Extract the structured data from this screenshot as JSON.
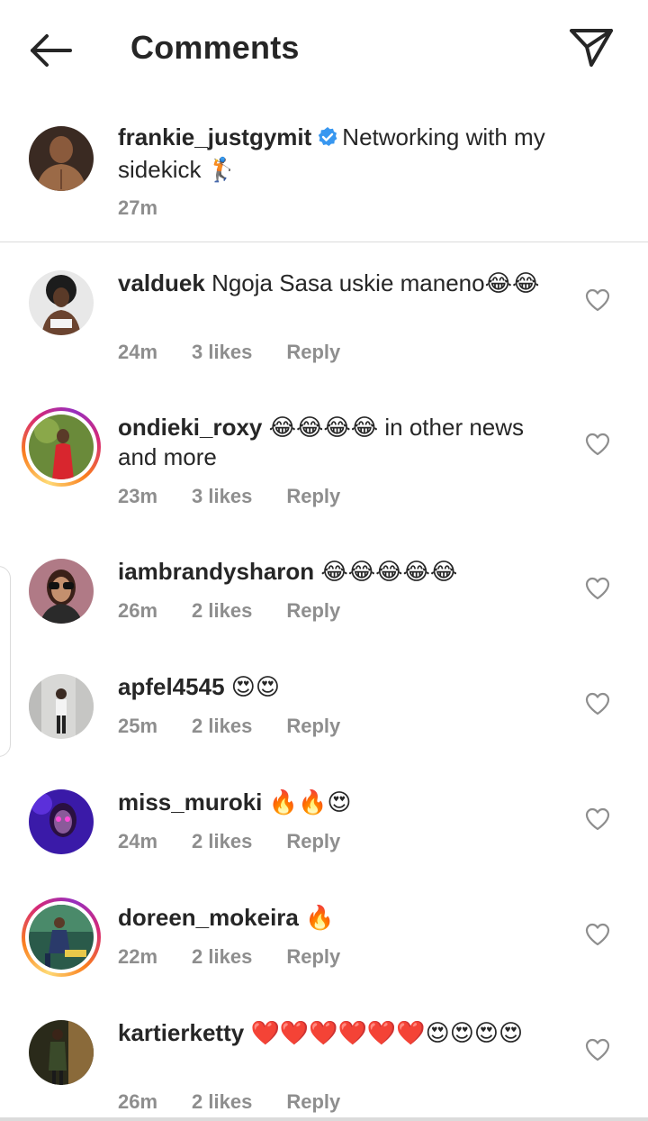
{
  "header": {
    "title": "Comments",
    "back_icon": "arrow-left-icon",
    "share_icon": "send-paper-plane-icon"
  },
  "caption": {
    "username": "frankie_justgymit",
    "verified": true,
    "text": "Networking with my sidekick 🏌",
    "time": "27m"
  },
  "comments": [
    {
      "username": "valduek",
      "text": "Ngoja Sasa uskie maneno😂😂",
      "time": "24m",
      "likes": "3 likes",
      "reply": "Reply",
      "story_ring": false
    },
    {
      "username": "ondieki_roxy",
      "text": "😂😂😂😂 in other news and more",
      "time": "23m",
      "likes": "3 likes",
      "reply": "Reply",
      "story_ring": true
    },
    {
      "username": "iambrandysharon",
      "text": "😂😂😂😂😂",
      "time": "26m",
      "likes": "2 likes",
      "reply": "Reply",
      "story_ring": false
    },
    {
      "username": "apfel4545",
      "text": "😍😍",
      "time": "25m",
      "likes": "2 likes",
      "reply": "Reply",
      "story_ring": false
    },
    {
      "username": "miss_muroki",
      "text": "🔥🔥😍",
      "time": "24m",
      "likes": "2 likes",
      "reply": "Reply",
      "story_ring": false
    },
    {
      "username": "doreen_mokeira",
      "text": "🔥",
      "time": "22m",
      "likes": "2 likes",
      "reply": "Reply",
      "story_ring": true
    },
    {
      "username": "kartierketty",
      "text": "❤️❤️❤️❤️❤️❤️😍😍😍😍",
      "time": "26m",
      "likes": "2 likes",
      "reply": "Reply",
      "story_ring": false
    }
  ],
  "colors": {
    "text": "#262626",
    "muted": "#8e8e8e",
    "verified": "#3897f0",
    "divider": "#dbdbdb"
  }
}
